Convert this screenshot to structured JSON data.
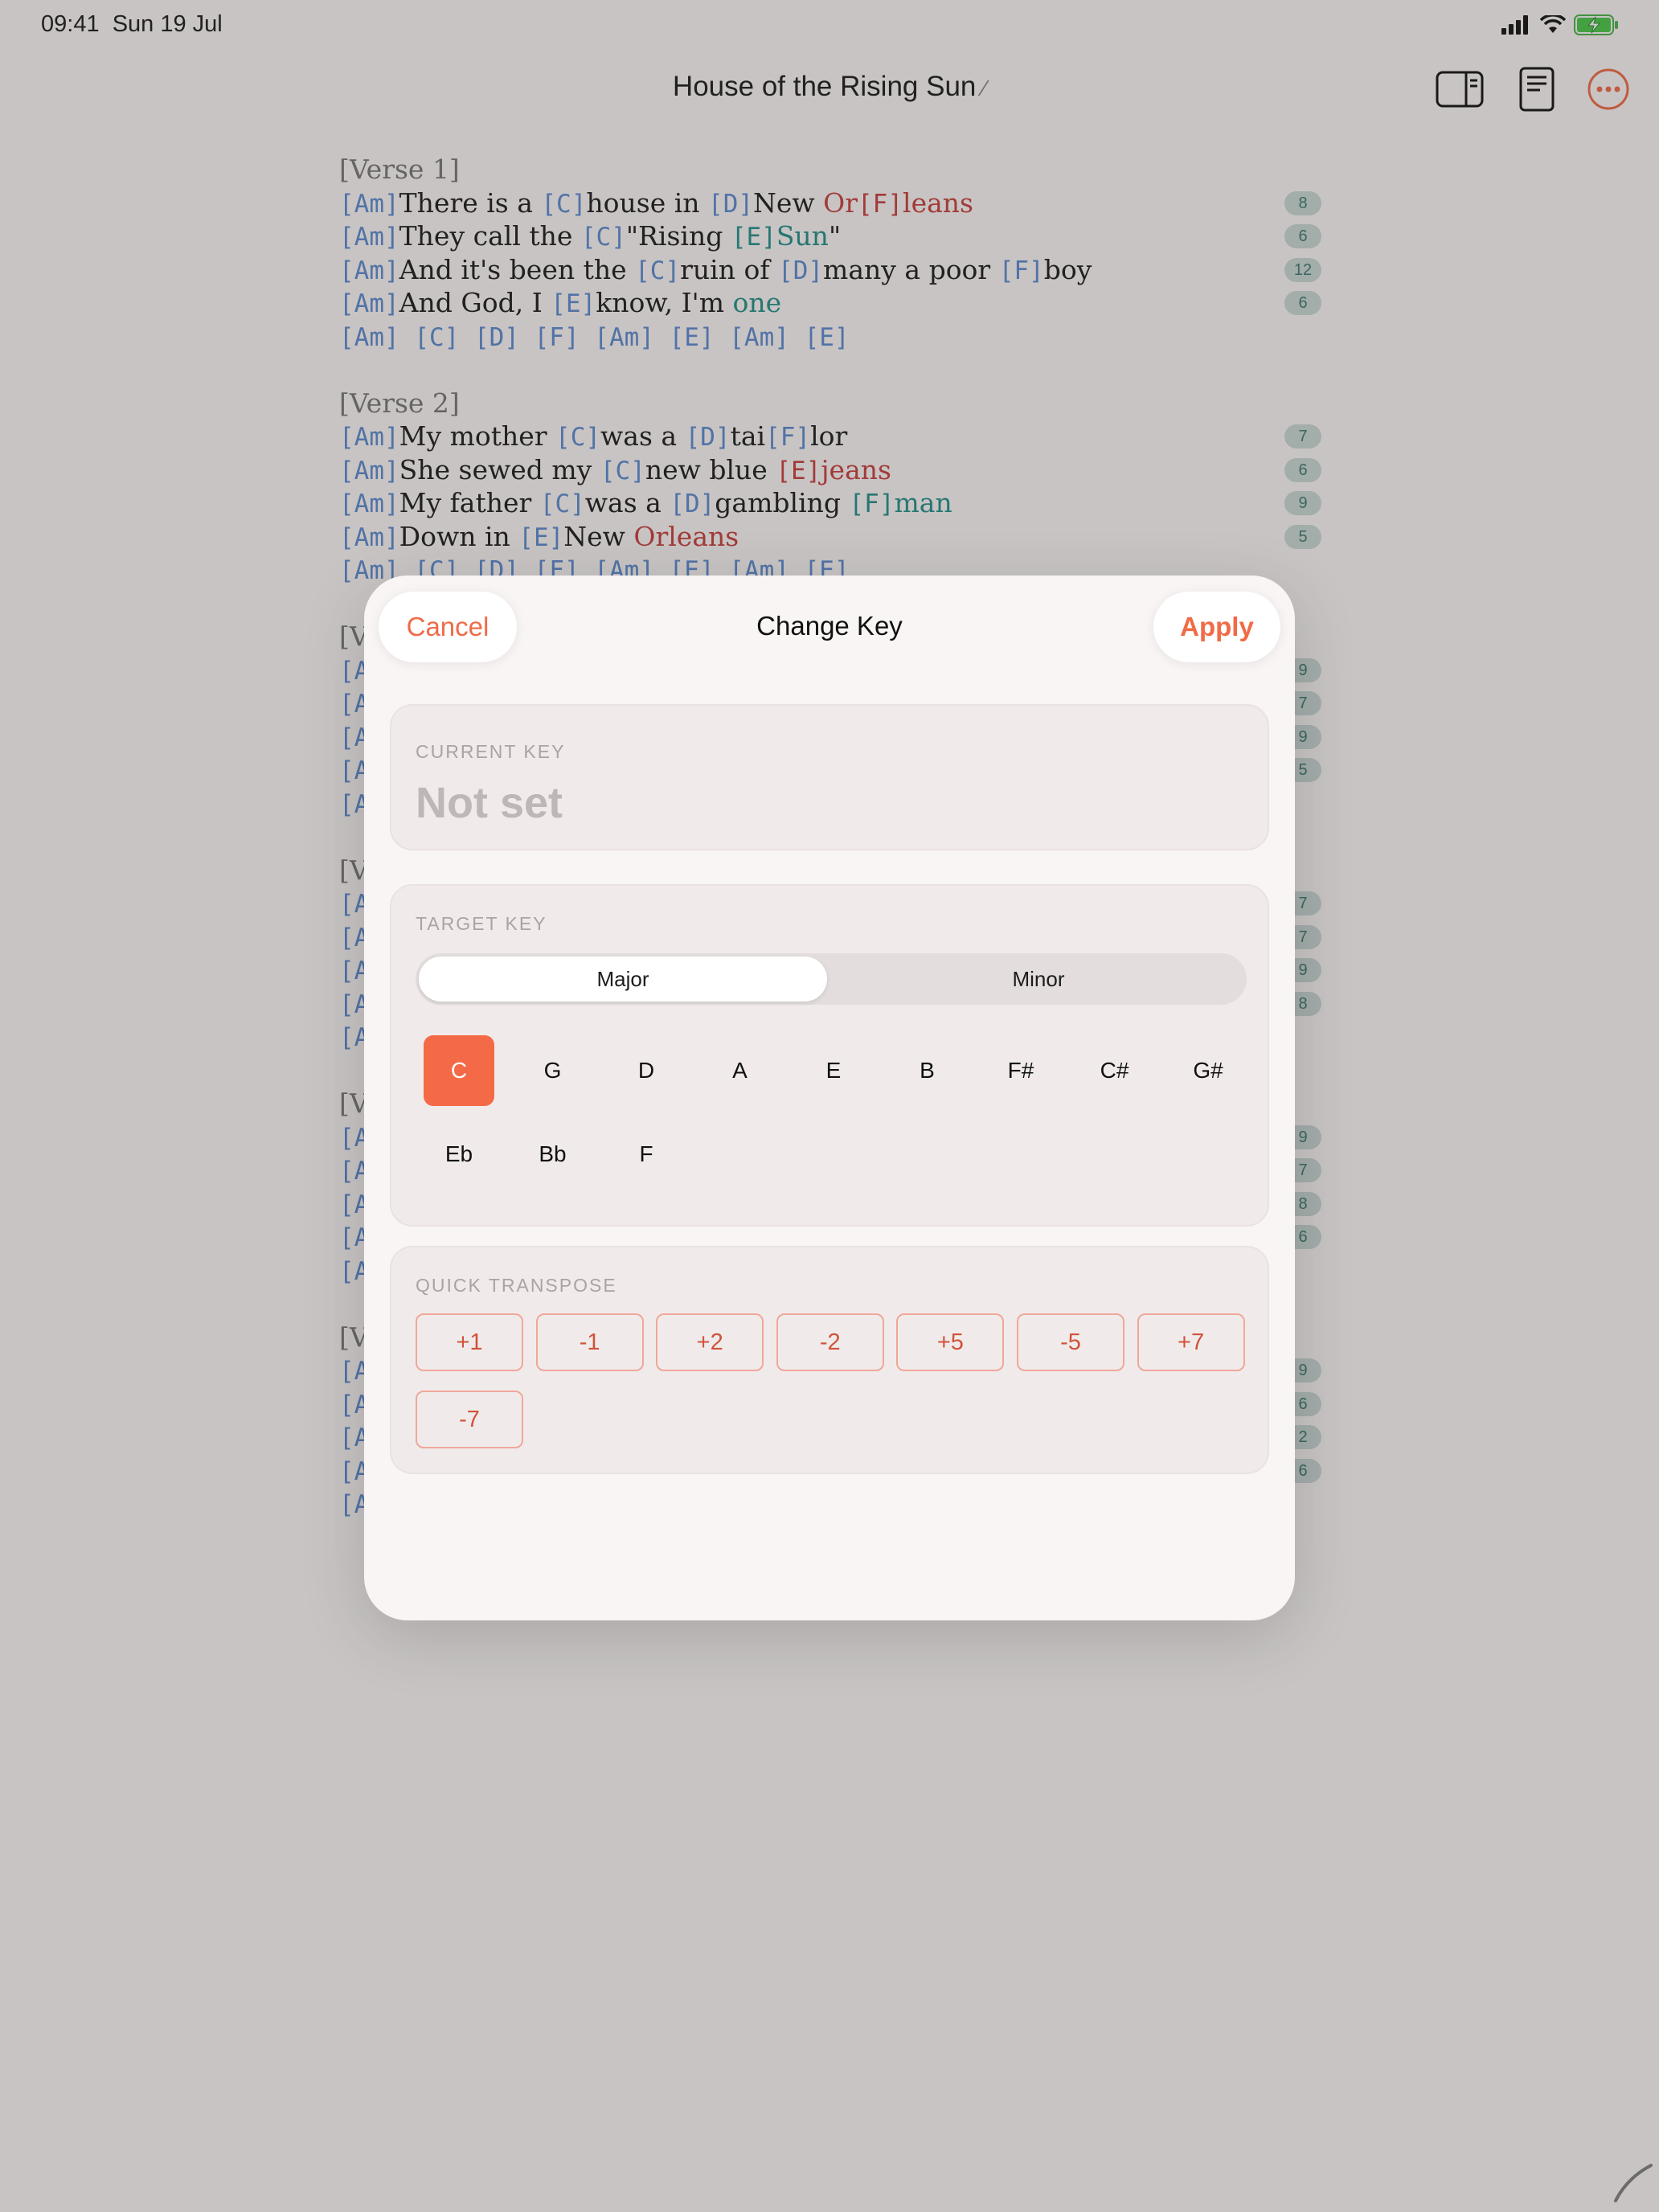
{
  "status_bar": {
    "time": "09:41",
    "date": "Sun 19 Jul"
  },
  "nav": {
    "title": "House of the Rising Sun",
    "icons": [
      "sidebar-toggle-icon",
      "document-icon",
      "more-options-icon"
    ],
    "accent": "#f06b47"
  },
  "song": {
    "lines": [
      {
        "type": "section",
        "text": "[Verse 1]"
      },
      {
        "type": "lyric",
        "badge": "8",
        "segments": [
          {
            "k": "c",
            "t": "[Am]"
          },
          {
            "k": "l",
            "t": "There is a "
          },
          {
            "k": "c",
            "t": "[C]"
          },
          {
            "k": "l",
            "t": "house in "
          },
          {
            "k": "c",
            "t": "[D]"
          },
          {
            "k": "l",
            "t": "New "
          },
          {
            "k": "r",
            "t": "Or"
          },
          {
            "k": "rc",
            "t": "[F]"
          },
          {
            "k": "r",
            "t": "leans"
          }
        ]
      },
      {
        "type": "lyric",
        "badge": "6",
        "segments": [
          {
            "k": "c",
            "t": "[Am]"
          },
          {
            "k": "l",
            "t": "They call the "
          },
          {
            "k": "c",
            "t": "[C]"
          },
          {
            "k": "l",
            "t": "\"Rising "
          },
          {
            "k": "tc",
            "t": "[E]"
          },
          {
            "k": "t",
            "t": "Sun"
          },
          {
            "k": "l",
            "t": "\""
          }
        ]
      },
      {
        "type": "lyric",
        "badge": "12",
        "segments": [
          {
            "k": "c",
            "t": "[Am]"
          },
          {
            "k": "l",
            "t": "And it's been the "
          },
          {
            "k": "c",
            "t": "[C]"
          },
          {
            "k": "l",
            "t": "ruin of "
          },
          {
            "k": "c",
            "t": "[D]"
          },
          {
            "k": "l",
            "t": "many a poor "
          },
          {
            "k": "c",
            "t": "[F]"
          },
          {
            "k": "l",
            "t": "boy"
          }
        ]
      },
      {
        "type": "lyric",
        "badge": "6",
        "segments": [
          {
            "k": "c",
            "t": "[Am]"
          },
          {
            "k": "l",
            "t": "And God, I "
          },
          {
            "k": "c",
            "t": "[E]"
          },
          {
            "k": "l",
            "t": "know, I'm "
          },
          {
            "k": "t",
            "t": "one"
          }
        ]
      },
      {
        "type": "lyric",
        "segments": [
          {
            "k": "c",
            "t": "[Am] [C] [D] [F] [Am] [E] [Am] [E]"
          }
        ]
      },
      {
        "type": "blank"
      },
      {
        "type": "section",
        "text": "[Verse 2]"
      },
      {
        "type": "lyric",
        "badge": "7",
        "segments": [
          {
            "k": "c",
            "t": "[Am]"
          },
          {
            "k": "l",
            "t": "My mother "
          },
          {
            "k": "c",
            "t": "[C]"
          },
          {
            "k": "l",
            "t": "was a "
          },
          {
            "k": "c",
            "t": "[D]"
          },
          {
            "k": "l",
            "t": "tai"
          },
          {
            "k": "c",
            "t": "[F]"
          },
          {
            "k": "l",
            "t": "lor"
          }
        ]
      },
      {
        "type": "lyric",
        "badge": "6",
        "segments": [
          {
            "k": "c",
            "t": "[Am]"
          },
          {
            "k": "l",
            "t": "She sewed my "
          },
          {
            "k": "c",
            "t": "[C]"
          },
          {
            "k": "l",
            "t": "new blue "
          },
          {
            "k": "rc",
            "t": "[E]"
          },
          {
            "k": "r",
            "t": "jeans"
          }
        ]
      },
      {
        "type": "lyric",
        "badge": "9",
        "segments": [
          {
            "k": "c",
            "t": "[Am]"
          },
          {
            "k": "l",
            "t": "My father "
          },
          {
            "k": "c",
            "t": "[C]"
          },
          {
            "k": "l",
            "t": "was a "
          },
          {
            "k": "c",
            "t": "[D]"
          },
          {
            "k": "l",
            "t": "gambling "
          },
          {
            "k": "tc",
            "t": "[F]"
          },
          {
            "k": "t",
            "t": "man"
          }
        ]
      },
      {
        "type": "lyric",
        "badge": "5",
        "segments": [
          {
            "k": "c",
            "t": "[Am]"
          },
          {
            "k": "l",
            "t": "Down in "
          },
          {
            "k": "c",
            "t": "[E]"
          },
          {
            "k": "l",
            "t": "New "
          },
          {
            "k": "r",
            "t": "Orleans"
          }
        ]
      },
      {
        "type": "lyric",
        "segments": [
          {
            "k": "c",
            "t": "[Am] [C] [D] [F] [Am] [E] [Am] [E]"
          }
        ]
      },
      {
        "type": "blank"
      },
      {
        "type": "section",
        "text": "[V"
      },
      {
        "type": "lyric",
        "badge": "9",
        "segments": [
          {
            "k": "c",
            "t": "[A"
          }
        ]
      },
      {
        "type": "lyric",
        "badge": "7",
        "segments": [
          {
            "k": "c",
            "t": "[A"
          }
        ]
      },
      {
        "type": "lyric",
        "badge": "9",
        "segments": [
          {
            "k": "c",
            "t": "[A"
          }
        ]
      },
      {
        "type": "lyric",
        "badge": "5",
        "segments": [
          {
            "k": "c",
            "t": "[A"
          }
        ]
      },
      {
        "type": "lyric",
        "segments": [
          {
            "k": "c",
            "t": "[A"
          }
        ]
      },
      {
        "type": "blank"
      },
      {
        "type": "section",
        "text": "[V"
      },
      {
        "type": "lyric",
        "badge": "7",
        "segments": [
          {
            "k": "c",
            "t": "[A"
          }
        ]
      },
      {
        "type": "lyric",
        "badge": "7",
        "segments": [
          {
            "k": "c",
            "t": "[A"
          }
        ]
      },
      {
        "type": "lyric",
        "badge": "9",
        "segments": [
          {
            "k": "c",
            "t": "[A"
          }
        ]
      },
      {
        "type": "lyric",
        "badge": "8",
        "segments": [
          {
            "k": "c",
            "t": "[A"
          }
        ]
      },
      {
        "type": "lyric",
        "segments": [
          {
            "k": "c",
            "t": "[A"
          }
        ]
      },
      {
        "type": "blank"
      },
      {
        "type": "section",
        "text": "[V"
      },
      {
        "type": "lyric",
        "badge": "9",
        "segments": [
          {
            "k": "c",
            "t": "[A"
          }
        ]
      },
      {
        "type": "lyric",
        "badge": "7",
        "segments": [
          {
            "k": "c",
            "t": "[A"
          }
        ]
      },
      {
        "type": "lyric",
        "badge": "8",
        "segments": [
          {
            "k": "c",
            "t": "[A"
          }
        ]
      },
      {
        "type": "lyric",
        "badge": "6",
        "segments": [
          {
            "k": "c",
            "t": "[A"
          }
        ]
      },
      {
        "type": "lyric",
        "segments": [
          {
            "k": "c",
            "t": "[A"
          }
        ]
      },
      {
        "type": "blank"
      },
      {
        "type": "section",
        "text": "[V"
      },
      {
        "type": "lyric",
        "badge": "9",
        "segments": [
          {
            "k": "c",
            "t": "[A"
          }
        ]
      },
      {
        "type": "lyric",
        "badge": "6",
        "segments": [
          {
            "k": "c",
            "t": "[A"
          }
        ]
      },
      {
        "type": "lyric",
        "badge": "2",
        "segments": [
          {
            "k": "c",
            "t": "[A"
          }
        ]
      },
      {
        "type": "lyric",
        "badge": "6",
        "segments": [
          {
            "k": "c",
            "t": "[A"
          }
        ]
      },
      {
        "type": "lyric",
        "segments": [
          {
            "k": "c",
            "t": "[A"
          }
        ]
      }
    ]
  },
  "modal": {
    "title": "Change Key",
    "cancel_label": "Cancel",
    "apply_label": "Apply",
    "current_key": {
      "label": "CURRENT KEY",
      "value": "Not set"
    },
    "target_key": {
      "label": "TARGET KEY",
      "modes": [
        "Major",
        "Minor"
      ],
      "selected_mode": "Major",
      "keys": [
        "C",
        "G",
        "D",
        "A",
        "E",
        "B",
        "F#",
        "C#",
        "G#",
        "Eb",
        "Bb",
        "F"
      ],
      "selected_key": "C"
    },
    "quick_transpose": {
      "label": "QUICK TRANSPOSE",
      "steps": [
        "+1",
        "-1",
        "+2",
        "-2",
        "+5",
        "-5",
        "+7",
        "-7"
      ]
    }
  }
}
